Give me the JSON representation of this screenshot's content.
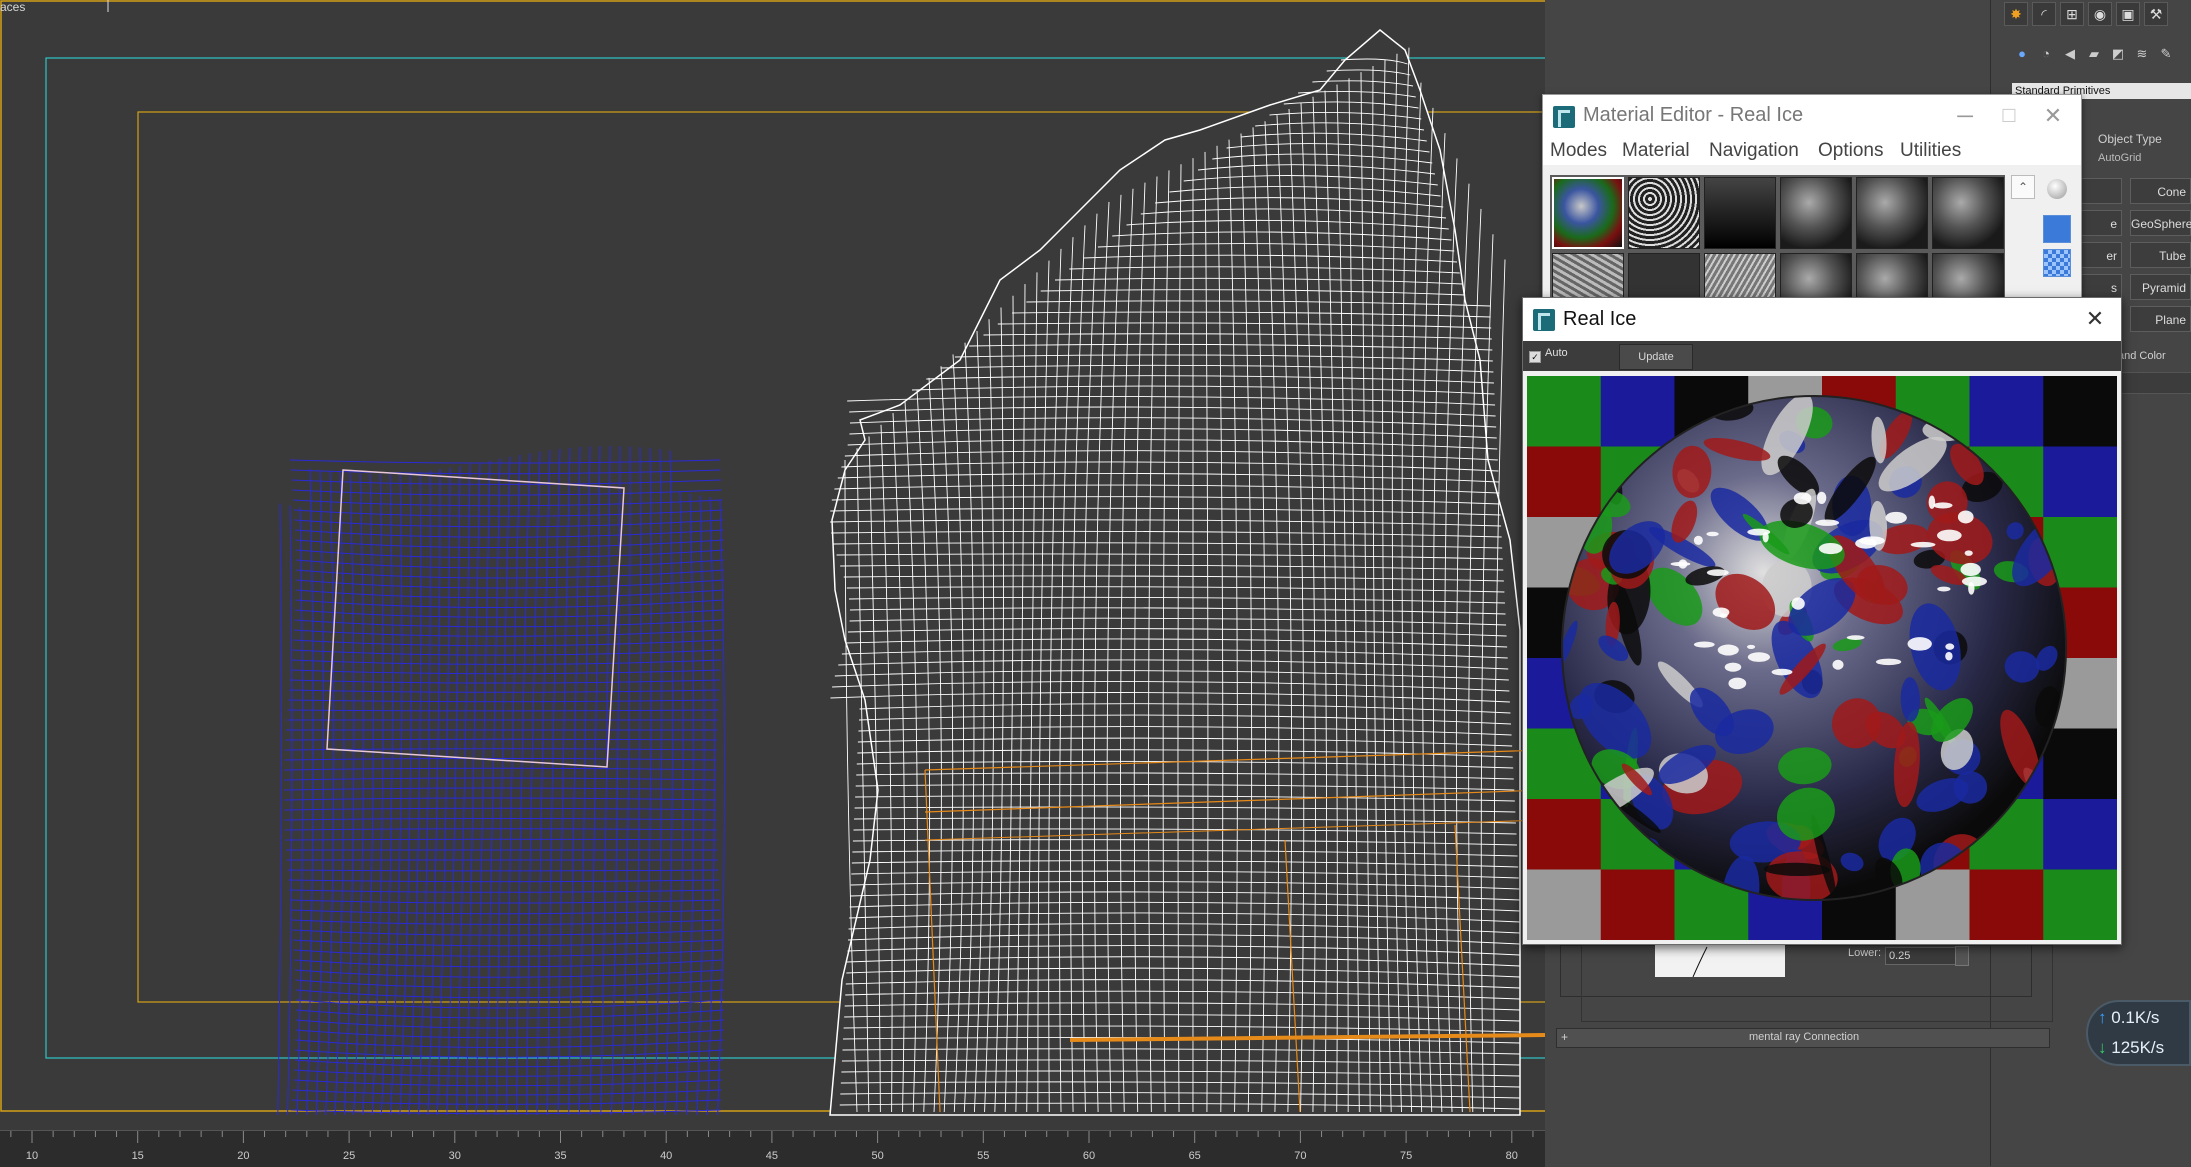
{
  "viewport": {
    "label": "aces",
    "wireframe_colors": {
      "blue_object": "#2a2ad6",
      "white_object": "#ffffff",
      "safe_frame_cyan": "#2ec6c6",
      "safe_frame_orange": "#d4a017",
      "gizmo_orange": "#e68a1a"
    }
  },
  "timeline": {
    "ticks": [
      "10",
      "15",
      "20",
      "25",
      "30",
      "35",
      "40",
      "45",
      "50",
      "55",
      "60",
      "65",
      "70",
      "75",
      "80"
    ]
  },
  "command_panel": {
    "dropdown": "Standard Primitives",
    "rollout_object_type": "Object Type",
    "autogrid": "AutoGrid",
    "buttons": [
      "Cone",
      "GeoSphere",
      "Tube",
      "Pyramid",
      "Plane"
    ],
    "left_buttons": [
      "e",
      "er",
      "s"
    ],
    "name_color": "and Color",
    "lower_label": "Lower:",
    "lower_value": "0.25",
    "mental_ray": "mental ray Connection",
    "plus": "+"
  },
  "material_editor": {
    "title": "Material Editor - Real Ice",
    "menus": [
      "Modes",
      "Material",
      "Navigation",
      "Options",
      "Utilities"
    ],
    "controls": {
      "minimize": "─",
      "maximize": "☐",
      "close": "✕"
    }
  },
  "real_ice": {
    "title": "Real Ice",
    "close": "✕",
    "auto_label": "Auto",
    "auto_checked": "✓",
    "update_label": "Update"
  },
  "net_speed": {
    "up_arrow": "↑",
    "down_arrow": "↓",
    "upload": "0.1K/s",
    "download": "125K/s"
  }
}
